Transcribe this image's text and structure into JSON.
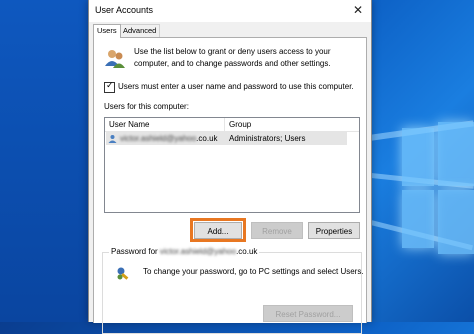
{
  "window": {
    "title": "User Accounts",
    "close_glyph": "✕"
  },
  "tabs": [
    {
      "label": "Users",
      "active": true
    },
    {
      "label": "Advanced",
      "active": false
    }
  ],
  "intro": {
    "icon": "users-icon",
    "text": "Use the list below to grant or deny users access to your computer, and to change passwords and other settings."
  },
  "require_login": {
    "checked": true,
    "label": "Users must enter a user name and password to use this computer."
  },
  "users_section": {
    "label": "Users for this computer:",
    "columns": [
      "User Name",
      "Group"
    ],
    "rows": [
      {
        "name_obscured": "victor.ashield@yahoo",
        "name_suffix": ".co.uk",
        "group": "Administrators; Users",
        "selected": true
      }
    ]
  },
  "buttons": {
    "add": "Add...",
    "remove": "Remove",
    "properties": "Properties",
    "reset_password": "Reset Password..."
  },
  "password_box": {
    "legend_prefix": "Password for ",
    "legend_obscured": "victor.ashield@yahoo",
    "legend_suffix": ".co.uk",
    "text": "To change your password, go to PC settings and select Users."
  },
  "colors": {
    "highlight_outline": "#e87722",
    "desktop_blue": "#0c5fc4"
  }
}
